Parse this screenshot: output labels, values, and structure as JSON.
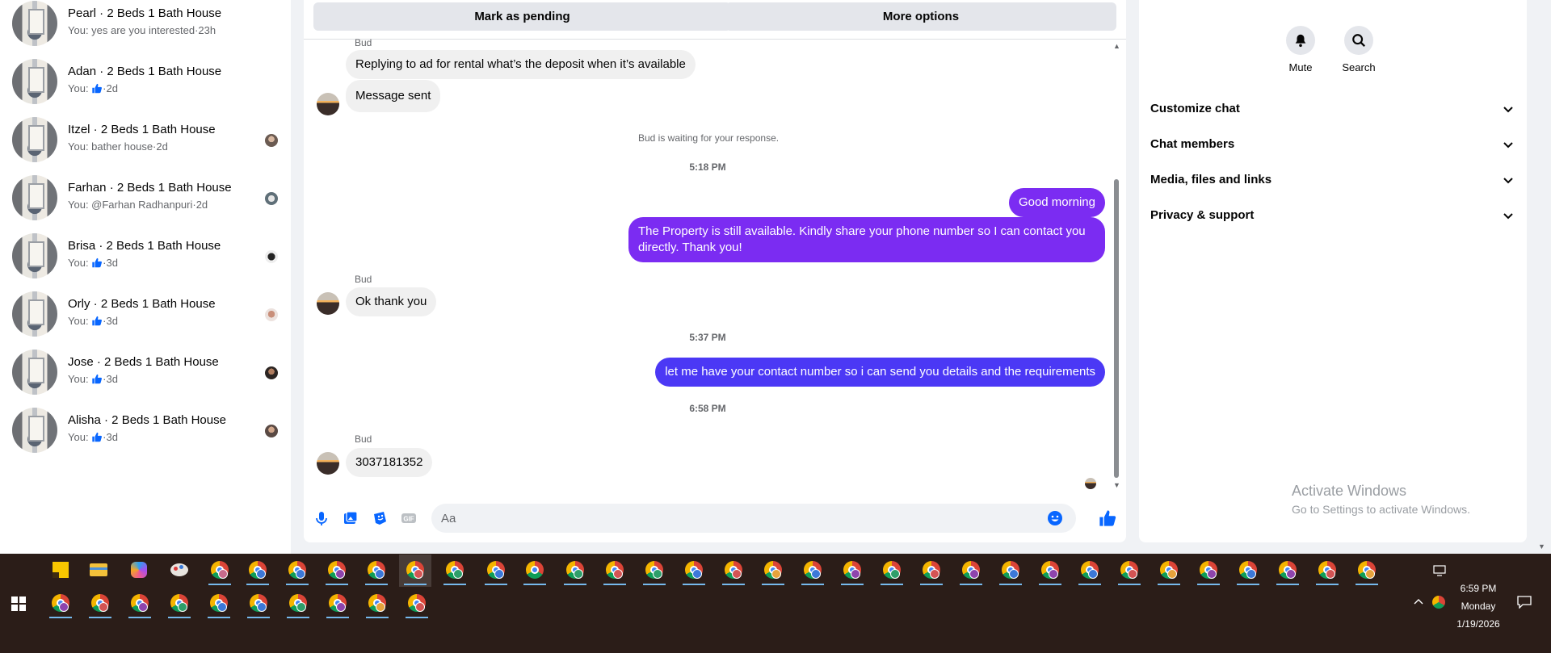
{
  "conversations": [
    {
      "name": "Pearl · 2 Beds 1 Bath House",
      "snippet": "You: yes are you interested·23h",
      "mini": false
    },
    {
      "name": "Adan · 2 Beds 1 Bath House",
      "snippet_prefix": "You: ",
      "snippet_suffix": "·2d",
      "like": true,
      "mini": false
    },
    {
      "name": "Itzel · 2 Beds 1 Bath House",
      "snippet": "You: bather house·2d",
      "mini": true
    },
    {
      "name": "Farhan · 2 Beds 1 Bath House",
      "snippet": "You: @Farhan Radhanpuri·2d",
      "mini": true
    },
    {
      "name": "Brisa · 2 Beds 1 Bath House",
      "snippet_prefix": "You: ",
      "snippet_suffix": "·3d",
      "like": true,
      "mini": true
    },
    {
      "name": "Orly · 2 Beds 1 Bath House",
      "snippet_prefix": "You: ",
      "snippet_suffix": "·3d",
      "like": true,
      "mini": true
    },
    {
      "name": "Jose · 2 Beds 1 Bath House",
      "snippet_prefix": "You: ",
      "snippet_suffix": "·3d",
      "like": true,
      "mini": true
    },
    {
      "name": "Alisha · 2 Beds 1 Bath House",
      "snippet_prefix": "You: ",
      "snippet_suffix": "·3d",
      "like": true,
      "mini": true
    }
  ],
  "toolbar": {
    "mark_pending": "Mark as pending",
    "more_options": "More options"
  },
  "chat": {
    "sender": "Bud",
    "msg1": "Replying to ad for rental what’s the deposit when it’s available",
    "msg2": "Message sent",
    "waiting": "Bud is waiting for your response.",
    "time1": "5:18 PM",
    "out1": "Good morning",
    "out2_line1": "The Property is still available. Kindly share your phone number so I can contact you",
    "out2_line2": "directly. Thank you!",
    "in3": "Ok thank you",
    "time2": "5:37 PM",
    "out3": "let me have your contact number so i can send you details and the requirements",
    "time3": "6:58 PM",
    "in4": "3037181352"
  },
  "composer": {
    "placeholder": "Aa"
  },
  "right_panel": {
    "mute": "Mute",
    "search": "Search",
    "sections": [
      "Customize chat",
      "Chat members",
      "Media, files and links",
      "Privacy & support"
    ]
  },
  "watermark": {
    "line1": "Activate Windows",
    "line2": "Go to Settings to activate Windows."
  },
  "clock": {
    "time": "6:59 PM",
    "day": "Monday",
    "date": "1/19/2026"
  },
  "colors": {
    "outgoing_purple": "#7b2cf2",
    "outgoing_blue": "#4b38f5",
    "accent": "#0866ff"
  }
}
